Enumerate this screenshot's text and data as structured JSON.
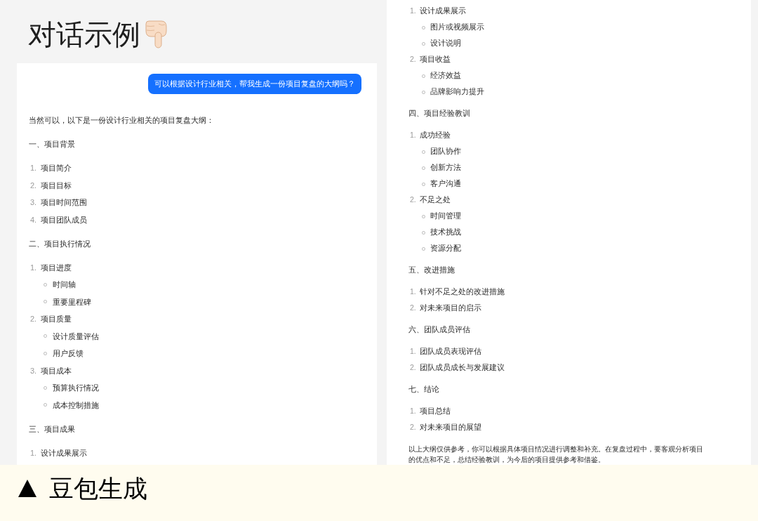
{
  "title": "对话示例",
  "left_panel": {
    "user_message": "可以根据设计行业相关，帮我生成一份项目复盘的大纲吗？",
    "reply_intro": "当然可以，以下是一份设计行业相关的项目复盘大纲：",
    "sections": [
      {
        "heading": "一、项目背景",
        "items": [
          {
            "number": "1.",
            "text": "项目简介"
          },
          {
            "number": "2.",
            "text": "项目目标"
          },
          {
            "number": "3.",
            "text": "项目时间范围"
          },
          {
            "number": "4.",
            "text": "项目团队成员"
          }
        ]
      },
      {
        "heading": "二、项目执行情况",
        "items": [
          {
            "number": "1.",
            "text": "项目进度",
            "children": [
              {
                "text": "时间轴"
              },
              {
                "text": "重要里程碑"
              }
            ]
          },
          {
            "number": "2.",
            "text": "项目质量",
            "children": [
              {
                "text": "设计质量评估"
              },
              {
                "text": "用户反馈"
              }
            ]
          },
          {
            "number": "3.",
            "text": "项目成本",
            "children": [
              {
                "text": "预算执行情况"
              },
              {
                "text": "成本控制措施"
              }
            ]
          }
        ]
      },
      {
        "heading": "三、项目成果",
        "items": [
          {
            "number": "1.",
            "text": "设计成果展示"
          }
        ]
      }
    ]
  },
  "right_panel": {
    "sections": [
      {
        "items": [
          {
            "number": "1.",
            "text": "设计成果展示",
            "children": [
              {
                "text": "图片或视频展示"
              },
              {
                "text": "设计说明"
              }
            ]
          },
          {
            "number": "2.",
            "text": "项目收益",
            "children": [
              {
                "text": "经济效益"
              },
              {
                "text": "品牌影响力提升"
              }
            ]
          }
        ]
      },
      {
        "heading": "四、项目经验教训",
        "items": [
          {
            "number": "1.",
            "text": "成功经验",
            "children": [
              {
                "text": "团队协作"
              },
              {
                "text": "创新方法"
              },
              {
                "text": "客户沟通"
              }
            ]
          },
          {
            "number": "2.",
            "text": "不足之处",
            "children": [
              {
                "text": "时间管理"
              },
              {
                "text": "技术挑战"
              },
              {
                "text": "资源分配"
              }
            ]
          }
        ]
      },
      {
        "heading": "五、改进措施",
        "items": [
          {
            "number": "1.",
            "text": "针对不足之处的改进措施"
          },
          {
            "number": "2.",
            "text": "对未来项目的启示"
          }
        ]
      },
      {
        "heading": "六、团队成员评估",
        "items": [
          {
            "number": "1.",
            "text": "团队成员表现评估"
          },
          {
            "number": "2.",
            "text": "团队成员成长与发展建议"
          }
        ]
      },
      {
        "heading": "七、结论",
        "items": [
          {
            "number": "1.",
            "text": "项目总结"
          },
          {
            "number": "2.",
            "text": "对未来项目的展望"
          }
        ]
      }
    ],
    "closing_note": "以上大纲仅供参考，你可以根据具体项目情况进行调整和补充。在复盘过程中，要客观分析项目的优点和不足，总结经验教训，为今后的项目提供参考和借鉴。"
  },
  "footer": {
    "caption": "豆包生成"
  }
}
